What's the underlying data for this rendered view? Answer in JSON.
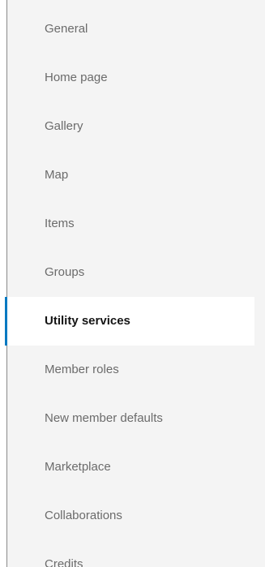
{
  "sidebar": {
    "accent_color": "#0079c1",
    "active_item": "Utility services",
    "items": [
      {
        "label": "General"
      },
      {
        "label": "Home page"
      },
      {
        "label": "Gallery"
      },
      {
        "label": "Map"
      },
      {
        "label": "Items"
      },
      {
        "label": "Groups"
      },
      {
        "label": "Utility services"
      },
      {
        "label": "Member roles"
      },
      {
        "label": "New member defaults"
      },
      {
        "label": "Marketplace"
      },
      {
        "label": "Collaborations"
      },
      {
        "label": "Credits"
      }
    ]
  }
}
